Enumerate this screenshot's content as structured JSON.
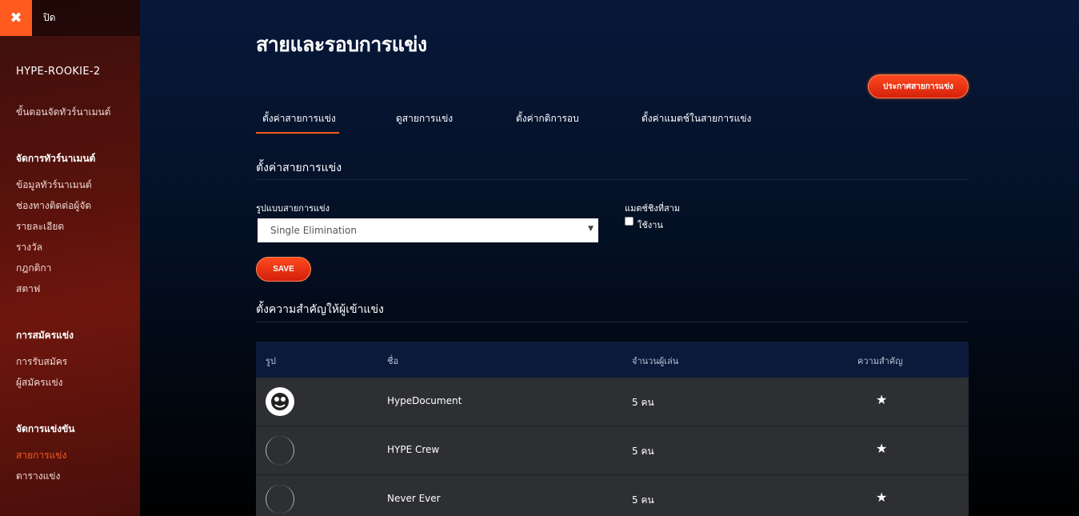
{
  "sidebar": {
    "close_label": "ปิด",
    "tournament_name": "HYPE-ROOKIE-2",
    "steps_link": "ขั้นตอนจัดทัวร์นาเมนต์",
    "sections": [
      {
        "title": "จัดการทัวร์นาเมนต์",
        "items": [
          "ข้อมูลทัวร์นาเมนต์",
          "ช่องทางติดต่อผู้จัด",
          "รายละเอียด",
          "รางวัล",
          "กฎกติกา",
          "สตาฟ"
        ]
      },
      {
        "title": "การสมัครแข่ง",
        "items": [
          "การรับสมัคร",
          "ผู้สมัครแข่ง"
        ]
      },
      {
        "title": "จัดการแข่งขัน",
        "items": [
          "สายการแข่ง",
          "ตารางแข่ง"
        ]
      }
    ]
  },
  "header": {
    "title": "สายและรอบการแข่ง",
    "announce_button": "ประกาศสายการแข่ง"
  },
  "tabs": [
    "ตั้งค่าสายการแข่ง",
    "ดูสายการแข่ง",
    "ตั้งค่ากติการอบ",
    "ตั้งค่าแมตช์ในสายการแข่ง"
  ],
  "settings": {
    "section_title": "ตั้งค่าสายการแข่ง",
    "format_label": "รูปแบบสายการแข่ง",
    "format_value": "Single Elimination",
    "third_place_label": "แมตช์ชิงที่สาม",
    "third_place_checkbox_label": "ใช้งาน",
    "save_button": "SAVE"
  },
  "seeding": {
    "section_title": "ตั้งความสำคัญให้ผู้เข้าแข่ง",
    "columns": [
      "รูป",
      "ชื่อ",
      "จำนวนผู้เล่น",
      "ความสำคัญ"
    ],
    "rows": [
      {
        "name": "HypeDocument",
        "players": "5 คน",
        "star_icon": "star-icon"
      },
      {
        "name": "HYPE Crew",
        "players": "5 คน",
        "star_icon": "star-icon"
      },
      {
        "name": "Never Ever",
        "players": "5 คน",
        "star_icon": "star-icon"
      }
    ]
  },
  "colors": {
    "accent": "#ff5a1f",
    "table_header": "#0b1a3a",
    "table_row": "#2e2f33"
  }
}
